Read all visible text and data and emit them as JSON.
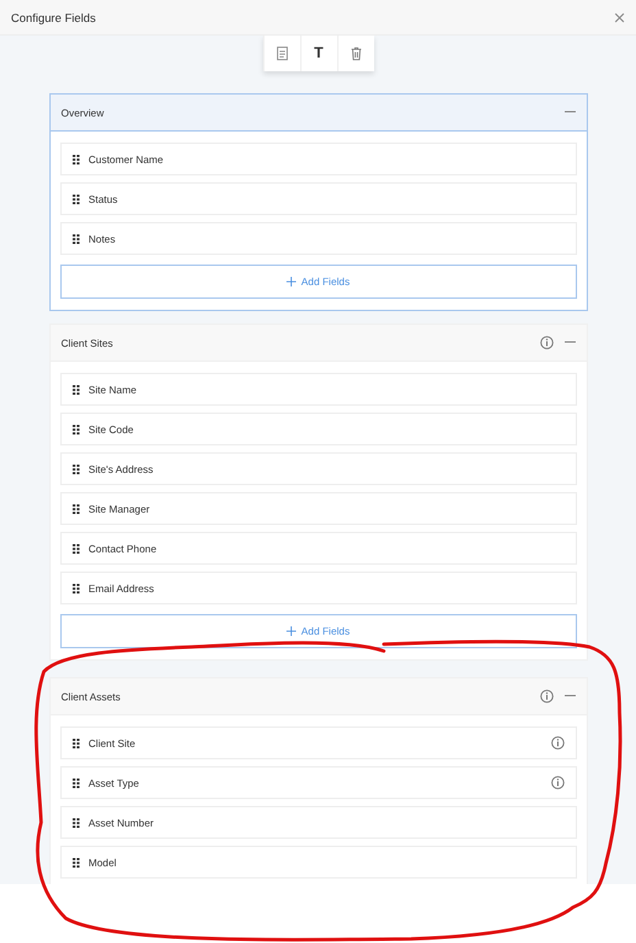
{
  "window": {
    "title": "Configure Fields"
  },
  "toolbar": [
    {
      "kind": "document"
    },
    {
      "kind": "text",
      "label": "T"
    },
    {
      "kind": "trash"
    }
  ],
  "sections": [
    {
      "title": "Overview",
      "selected": true,
      "info": false,
      "fields": [
        {
          "name": "Customer Name",
          "info": false
        },
        {
          "name": "Status",
          "info": false
        },
        {
          "name": "Notes",
          "info": false
        }
      ],
      "add_button": "Add Fields"
    },
    {
      "title": "Client Sites",
      "selected": false,
      "info": true,
      "fields": [
        {
          "name": "Site Name",
          "info": false
        },
        {
          "name": "Site Code",
          "info": false
        },
        {
          "name": "Site's Address",
          "info": false
        },
        {
          "name": "Site Manager",
          "info": false
        },
        {
          "name": "Contact Phone",
          "info": false
        },
        {
          "name": "Email Address",
          "info": false
        }
      ],
      "add_button": "Add Fields"
    },
    {
      "title": "Client Assets",
      "selected": false,
      "info": true,
      "fields": [
        {
          "name": "Client Site",
          "info": true
        },
        {
          "name": "Asset Type",
          "info": true
        },
        {
          "name": "Asset Number",
          "info": false
        },
        {
          "name": "Model",
          "info": false
        }
      ]
    }
  ],
  "annotation": {
    "kind": "freehand-outline"
  }
}
